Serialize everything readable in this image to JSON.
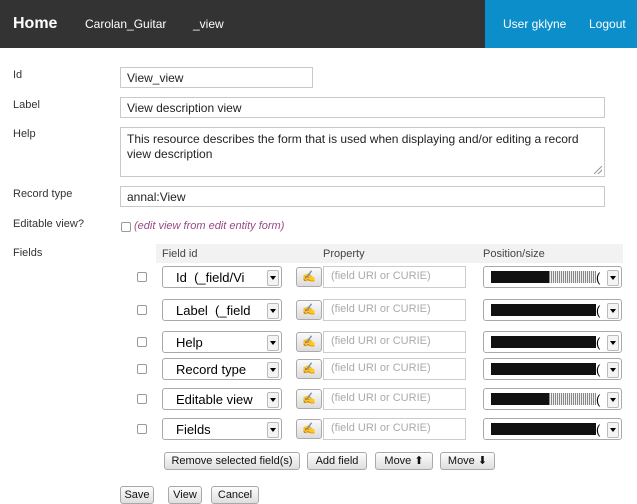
{
  "nav": {
    "home": "Home",
    "collection": "Carolan_Guitar",
    "view": "_view",
    "user": "User gklyne",
    "logout": "Logout"
  },
  "form": {
    "id_label": "Id",
    "id_value": "View_view",
    "label_label": "Label",
    "label_value": "View description view",
    "help_label": "Help",
    "help_value": "This resource describes the form that is used when displaying and/or editing a record view description",
    "record_type_label": "Record type",
    "record_type_value": "annal:View",
    "editable_label": "Editable view?",
    "editable_checked": false,
    "editable_note": "(edit view from edit entity form)",
    "fields_label": "Fields"
  },
  "fields_table": {
    "headers": [
      "Field id",
      "Property",
      "Position/size"
    ],
    "property_placeholder": "(field URI or CURIE)",
    "rows": [
      {
        "field": "Id  (_field/Vi",
        "size_fill": 0.55,
        "checked": false
      },
      {
        "field": "Label  (_field",
        "size_fill": 1.0,
        "checked": false
      },
      {
        "field": "Help",
        "size_fill": 1.0,
        "checked": false
      },
      {
        "field": "Record type",
        "size_fill": 1.0,
        "checked": false
      },
      {
        "field": "Editable view",
        "size_fill": 0.55,
        "checked": false
      },
      {
        "field": "Fields",
        "size_fill": 1.0,
        "checked": false
      }
    ],
    "paren": "(",
    "remove_button": "Remove selected field(s)",
    "add_button": "Add field",
    "move_up_button": "Move ⬆",
    "move_down_button": "Move ⬇"
  },
  "actions": {
    "save": "Save",
    "view": "View",
    "cancel": "Cancel"
  },
  "colors": {
    "topbar": "#333333",
    "user_area": "#0b8ec9",
    "note": "#9a4a84"
  }
}
